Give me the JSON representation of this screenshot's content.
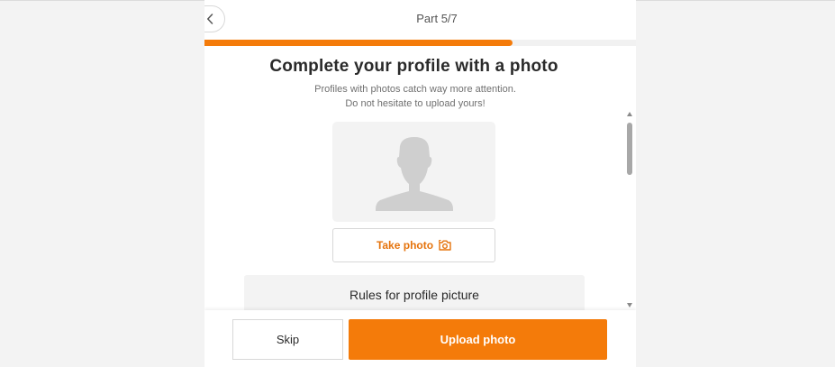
{
  "header": {
    "step_label": "Part 5/7",
    "progress_fraction": 0.714
  },
  "main": {
    "title": "Complete your profile with a photo",
    "subtitle": "Profiles with photos catch way more attention. Do not hesitate to upload yours!",
    "take_photo_label": "Take photo",
    "rules_label": "Rules for profile picture"
  },
  "footer": {
    "skip_label": "Skip",
    "upload_label": "Upload photo"
  },
  "colors": {
    "accent": "#f47b0a",
    "accent_text": "#e5730c"
  },
  "icons": {
    "back": "chevron-left-icon",
    "avatar": "person-silhouette-icon",
    "camera": "camera-icon"
  }
}
